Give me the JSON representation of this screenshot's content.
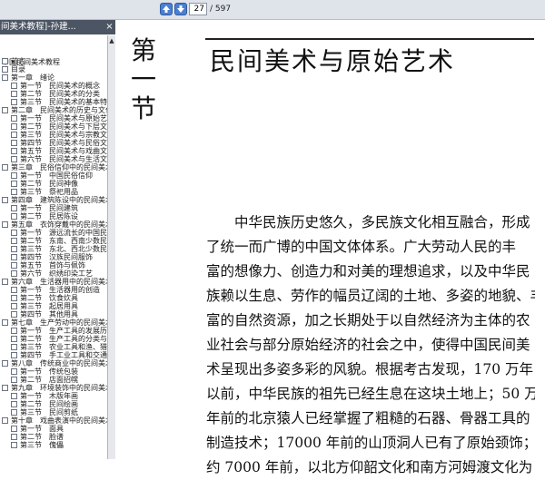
{
  "toolbar": {
    "prev_icon": "up-arrow-icon",
    "next_icon": "down-arrow-icon",
    "page_current": "27",
    "page_total": "/ 597"
  },
  "document_tab": {
    "title": "间美术教程]-孙建...",
    "close_glyph": "×",
    "close_icon": "close-icon"
  },
  "sidebar": {
    "root_label": "中国民间美术教程",
    "items": [
      {
        "level": 0,
        "label": "前言"
      },
      {
        "level": 0,
        "label": "目录"
      },
      {
        "level": 0,
        "label": "第一章　绪论"
      },
      {
        "level": 1,
        "label": "第一节　民间美术的概念"
      },
      {
        "level": 1,
        "label": "第二节　民间美术的分类"
      },
      {
        "level": 1,
        "label": "第三节　民间美术的基本特"
      },
      {
        "level": 0,
        "label": "第二章　民间美术的历史与文化"
      },
      {
        "level": 1,
        "label": "第一节　民间美术与原始艺"
      },
      {
        "level": 1,
        "label": "第二节　民间美术与下层文"
      },
      {
        "level": 1,
        "label": "第三节　民间美术与宗教文"
      },
      {
        "level": 1,
        "label": "第四节　民间美术与民俗文"
      },
      {
        "level": 1,
        "label": "第五节　民间美术与戏曲文"
      },
      {
        "level": 1,
        "label": "第六节　民间美术与生活文"
      },
      {
        "level": 0,
        "label": "第三章　民俗信仰中的民间美术"
      },
      {
        "level": 1,
        "label": "第一节　中国民俗信仰"
      },
      {
        "level": 1,
        "label": "第二节　民间神像"
      },
      {
        "level": 1,
        "label": "第三节　祭祀用品"
      },
      {
        "level": 0,
        "label": "第四章　建筑陈设中的民间美术"
      },
      {
        "level": 1,
        "label": "第一节　民间建筑"
      },
      {
        "level": 1,
        "label": "第二节　民居陈设"
      },
      {
        "level": 0,
        "label": "第五章　衣饰穿戴中的民间美术"
      },
      {
        "level": 1,
        "label": "第一节　源远流长的中国民"
      },
      {
        "level": 1,
        "label": "第二节　东南、西南少数民"
      },
      {
        "level": 1,
        "label": "第三节　东北、西北少数民"
      },
      {
        "level": 1,
        "label": "第四节　汉族民间服饰"
      },
      {
        "level": 1,
        "label": "第五节　首饰与佩饰"
      },
      {
        "level": 1,
        "label": "第六节　织绣印染工艺"
      },
      {
        "level": 0,
        "label": "第六章　生活器用中的民间美术"
      },
      {
        "level": 1,
        "label": "第一节　生活器用的创造"
      },
      {
        "level": 1,
        "label": "第二节　饮食炊具"
      },
      {
        "level": 1,
        "label": "第三节　起居用具"
      },
      {
        "level": 1,
        "label": "第四节　其他用具"
      },
      {
        "level": 0,
        "label": "第七章　生产劳动中的民间美术"
      },
      {
        "level": 1,
        "label": "第一节　生产工具的发展历"
      },
      {
        "level": 1,
        "label": "第二节　生产工具的分类与"
      },
      {
        "level": 1,
        "label": "第三节　农业工具和渔、猎"
      },
      {
        "level": 1,
        "label": "第四节　手工业工具和交通"
      },
      {
        "level": 0,
        "label": "第八章　传统商业中的民间美术"
      },
      {
        "level": 1,
        "label": "第一节　传统包装"
      },
      {
        "level": 1,
        "label": "第二节　店面招幌"
      },
      {
        "level": 0,
        "label": "第九章　环境装饰中的民间美术"
      },
      {
        "level": 1,
        "label": "第一节　木版年画"
      },
      {
        "level": 1,
        "label": "第二节　民间绘画"
      },
      {
        "level": 1,
        "label": "第三节　民间剪纸"
      },
      {
        "level": 0,
        "label": "第十章　戏曲表演中的民间美术"
      },
      {
        "level": 1,
        "label": "第一节　面具"
      },
      {
        "level": 1,
        "label": "第二节　脸谱"
      },
      {
        "level": 1,
        "label": "第三节　傀儡"
      }
    ]
  },
  "page": {
    "chapter_chars": [
      "第",
      "一",
      "节"
    ],
    "title": "民间美术与原始艺术",
    "body_lines": [
      "　　中华民族历史悠久，多民族文化相互融合，形成",
      "了统一而广博的中国文体体系。广大劳动人民的丰",
      "富的想像力、创造力和对美的理想追求，以及中华民",
      "族赖以生息、劳作的幅员辽阔的土地、多姿的地貌、丰",
      "富的自然资源，加之长期处于以自然经济为主体的农",
      "业社会与部分原始经济的社会之中，使得中国民间美",
      "术呈现出多姿多彩的风貌。根据考古发现，170 万年",
      "以前，中华民族的祖先已经生息在这块土地上；50 万",
      "年前的北京猿人已经掌握了粗糙的石器、骨器工具的",
      "制造技术；17000 年前的山顶洞人已有了原始颈饰；",
      "约 7000 年前，以北方仰韶文化和南方河姆渡文化为"
    ]
  },
  "colors": {
    "toolbar_bg": "#dfe3ea",
    "titlebar_bg": "#4b5563",
    "nav_button": "#4a7fd0"
  }
}
